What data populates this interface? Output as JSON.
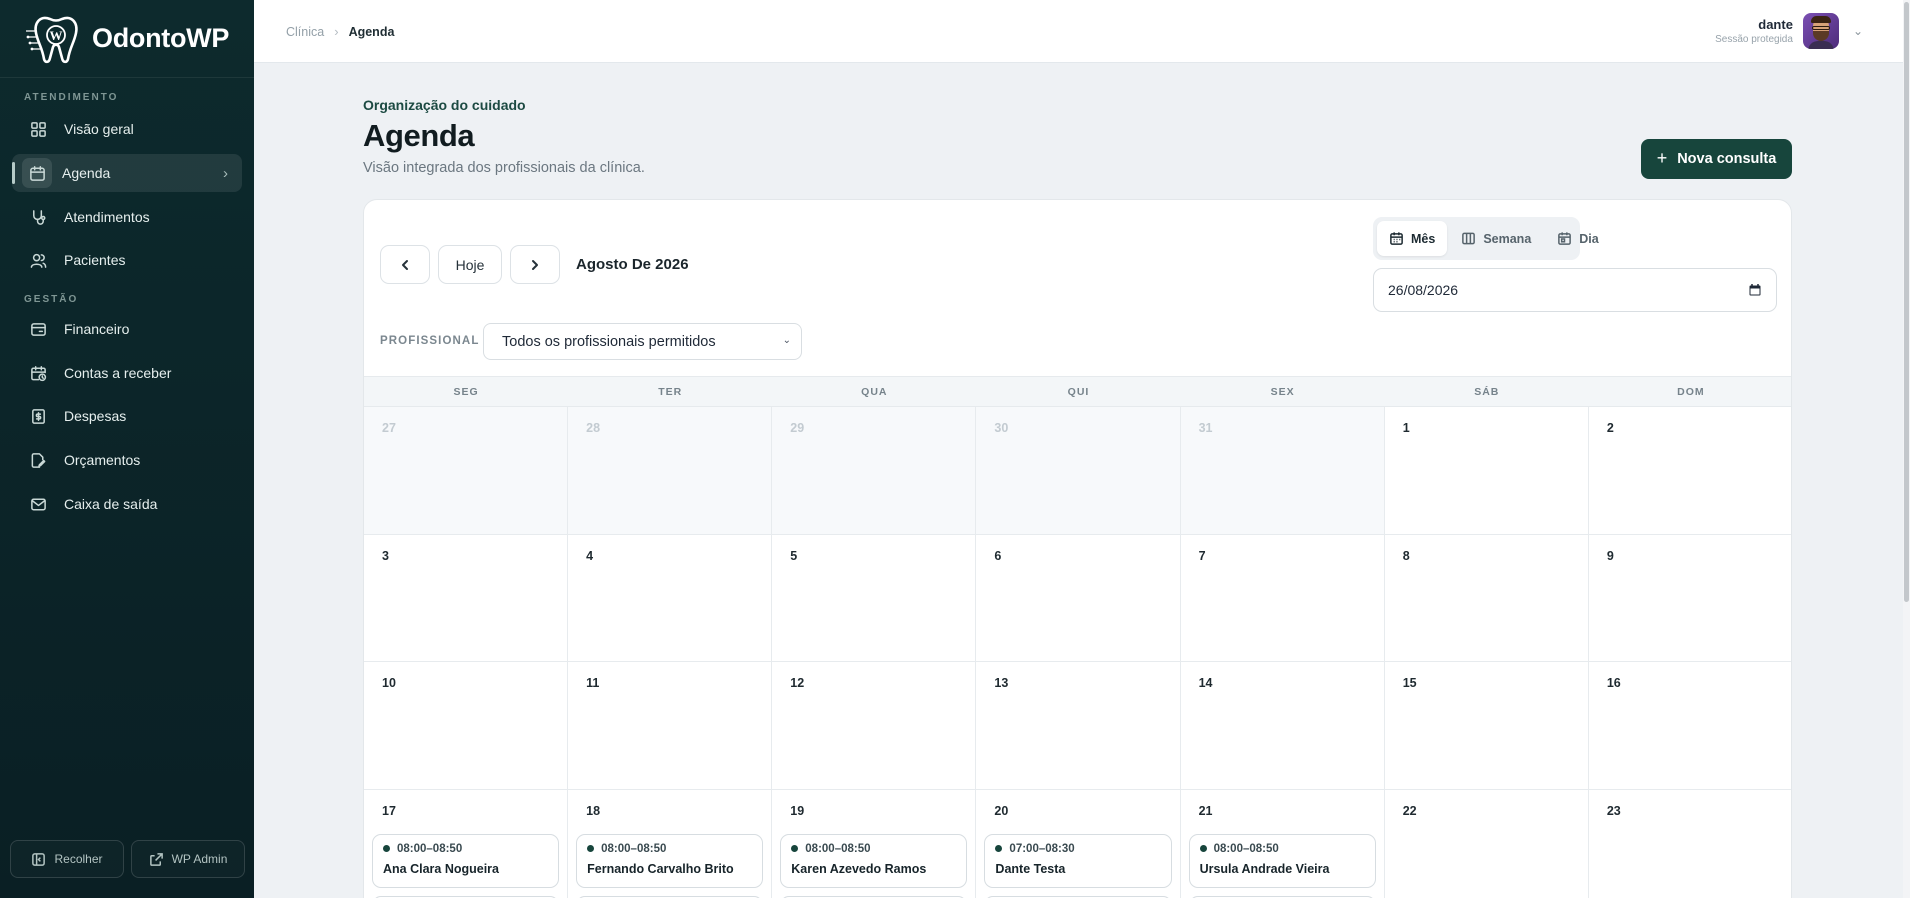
{
  "brand": {
    "name": "OdontoWP"
  },
  "sidebar": {
    "sections": [
      {
        "label": "ATENDIMENTO"
      },
      {
        "label": "GESTÃO"
      }
    ],
    "items": [
      {
        "label": "Visão geral",
        "icon": "grid-icon"
      },
      {
        "label": "Agenda",
        "icon": "calendar-icon",
        "active": true
      },
      {
        "label": "Atendimentos",
        "icon": "stethoscope-icon"
      },
      {
        "label": "Pacientes",
        "icon": "users-icon"
      },
      {
        "label": "Financeiro",
        "icon": "wallet-icon"
      },
      {
        "label": "Contas a receber",
        "icon": "calendar-clock-icon"
      },
      {
        "label": "Despesas",
        "icon": "receipt-icon"
      },
      {
        "label": "Orçamentos",
        "icon": "file-edit-icon"
      },
      {
        "label": "Caixa de saída",
        "icon": "mail-icon"
      }
    ],
    "footer": {
      "collapse_label": "Recolher",
      "wp_admin_label": "WP Admin"
    }
  },
  "topbar": {
    "breadcrumb": [
      "Clínica",
      "Agenda"
    ],
    "user": {
      "name": "dante",
      "subtitle": "Sessão protegida"
    }
  },
  "page": {
    "kicker": "Organização do cuidado",
    "title": "Agenda",
    "subtitle": "Visão integrada dos profissionais da clínica.",
    "new_button": "Nova consulta"
  },
  "calendar": {
    "today_label": "Hoje",
    "month_label": "Agosto De 2026",
    "views": [
      "Mês",
      "Semana",
      "Dia"
    ],
    "active_view": "Mês",
    "date_value": "26/08/2026",
    "professional_label": "PROFISSIONAL",
    "professional_selected": "Todos os profissionais permitidos",
    "weekdays": [
      "SEG",
      "TER",
      "QUA",
      "QUI",
      "SEX",
      "SÁB",
      "DOM"
    ],
    "days": [
      {
        "n": "27",
        "out": true
      },
      {
        "n": "28",
        "out": true
      },
      {
        "n": "29",
        "out": true
      },
      {
        "n": "30",
        "out": true
      },
      {
        "n": "31",
        "out": true
      },
      {
        "n": "1"
      },
      {
        "n": "2"
      },
      {
        "n": "3"
      },
      {
        "n": "4"
      },
      {
        "n": "5"
      },
      {
        "n": "6"
      },
      {
        "n": "7"
      },
      {
        "n": "8"
      },
      {
        "n": "9"
      },
      {
        "n": "10"
      },
      {
        "n": "11"
      },
      {
        "n": "12"
      },
      {
        "n": "13"
      },
      {
        "n": "14"
      },
      {
        "n": "15"
      },
      {
        "n": "16"
      },
      {
        "n": "17",
        "event": {
          "time": "08:00–08:50",
          "patient": "Ana Clara Nogueira"
        }
      },
      {
        "n": "18",
        "event": {
          "time": "08:00–08:50",
          "patient": "Fernando Carvalho Brito"
        }
      },
      {
        "n": "19",
        "event": {
          "time": "08:00–08:50",
          "patient": "Karen Azevedo Ramos"
        }
      },
      {
        "n": "20",
        "event": {
          "time": "07:00–08:30",
          "patient": "Dante Testa"
        }
      },
      {
        "n": "21",
        "event": {
          "time": "08:00–08:50",
          "patient": "Ursula Andrade Vieira"
        }
      },
      {
        "n": "22"
      },
      {
        "n": "23"
      }
    ]
  }
}
